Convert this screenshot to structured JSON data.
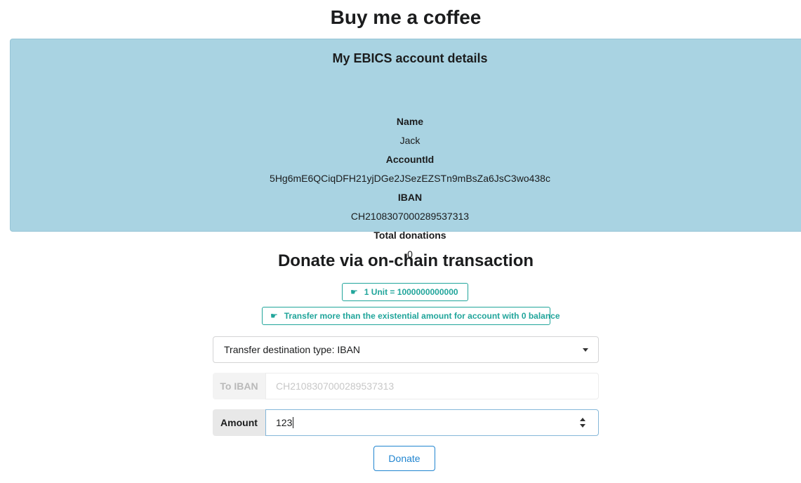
{
  "page": {
    "title": "Buy me a coffee"
  },
  "account": {
    "title": "My EBICS account details",
    "name_label": "Name",
    "name_value": "Jack",
    "account_id_label": "AccountId",
    "account_id_value": "5Hg6mE6QCiqDFH21yjDGe2JSezEZSTn9mBsZa6JsC3wo438c",
    "iban_label": "IBAN",
    "iban_value": "CH2108307000289537313",
    "donations_label": "Total donations",
    "donations_value": "0"
  },
  "donate": {
    "title": "Donate via on-chain transaction",
    "unit_badge": "1 Unit = 1000000000000",
    "existential_badge": "Transfer more than the existential amount for account with 0 balance",
    "badge_icon": "hand-pointing-right-icon",
    "destination_dropdown": "Transfer destination type: IBAN",
    "to_iban_label": "To IBAN",
    "to_iban_value": "CH2108307000289537313",
    "amount_label": "Amount",
    "amount_value": "123",
    "donate_button": "Donate"
  },
  "colors": {
    "card_background": "#a9d3e2",
    "teal_accent": "#21a59b",
    "blue_accent": "#2185d0"
  }
}
